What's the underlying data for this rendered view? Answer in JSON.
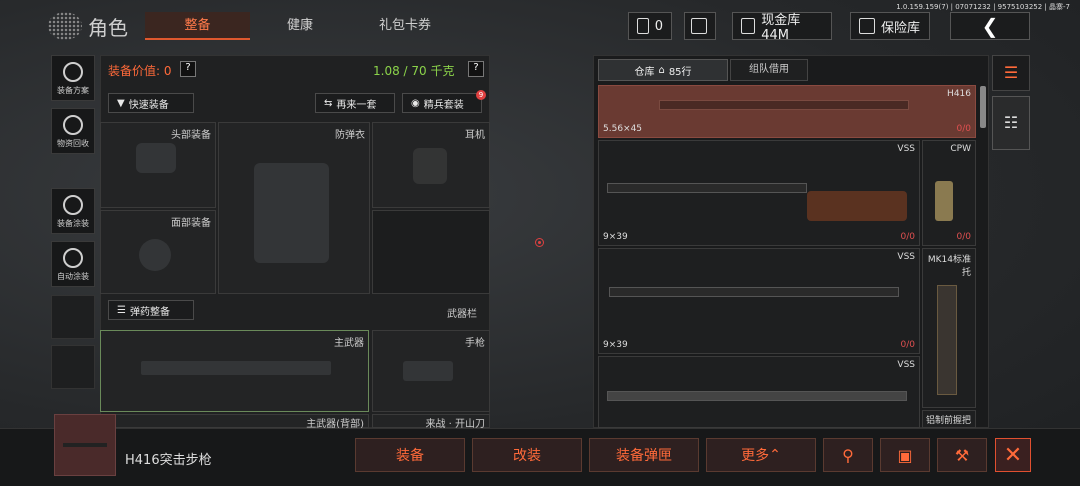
{
  "header": {
    "title": "角色",
    "tabs": [
      "整备",
      "健康",
      "礼包卡券"
    ],
    "version": "1.0.159.159(7) | 07071232 | 9575103252 | 晶寨-7",
    "ticket_count": "0",
    "cash": "现金库 44M",
    "safe": "保险库"
  },
  "sidebar": {
    "items": [
      "装备方案",
      "物资回收",
      "装备涂装",
      "自动涂装"
    ]
  },
  "equip": {
    "value_label": "装备价值: 0",
    "weight": "1.08 / 70 千克",
    "quick_btn": "快速装备",
    "again_btn": "再来一套",
    "elite_btn": "精兵套装",
    "elite_badge": "9",
    "slots": {
      "head": "头部装备",
      "armor": "防弹衣",
      "ear": "耳机",
      "face": "面部装备"
    },
    "ammo_btn": "弹药整备",
    "weapon_bar": "武器栏",
    "primary": "主武器",
    "pistol": "手枪",
    "primary_back": "主武器(背部)",
    "melee": "来战 · 开山刀"
  },
  "warehouse": {
    "tab1": "仓库",
    "tab1_count": "85行",
    "tab2": "组队借用",
    "items": [
      {
        "name": "H416",
        "caliber": "5.56×45",
        "count": "0/0"
      },
      {
        "name": "VSS",
        "caliber": "9×39",
        "count": "0/0"
      },
      {
        "name": "CPW",
        "caliber": "",
        "count": "0/0"
      },
      {
        "name": "VSS",
        "caliber": "9×39",
        "count": "0/0"
      },
      {
        "name": "MK14标准托",
        "caliber": "",
        "count": ""
      },
      {
        "name": "VSS",
        "caliber": "",
        "count": ""
      },
      {
        "name": "铝制前握把",
        "caliber": "",
        "count": ""
      }
    ]
  },
  "bottom": {
    "item_name": "H416突击步枪",
    "equip": "装备",
    "modify": "改装",
    "equip_mag": "装备弹匣",
    "more": "更多"
  },
  "colors": {
    "accent": "#ff6a3a",
    "green": "#8bd34a",
    "red": "#e05050"
  }
}
